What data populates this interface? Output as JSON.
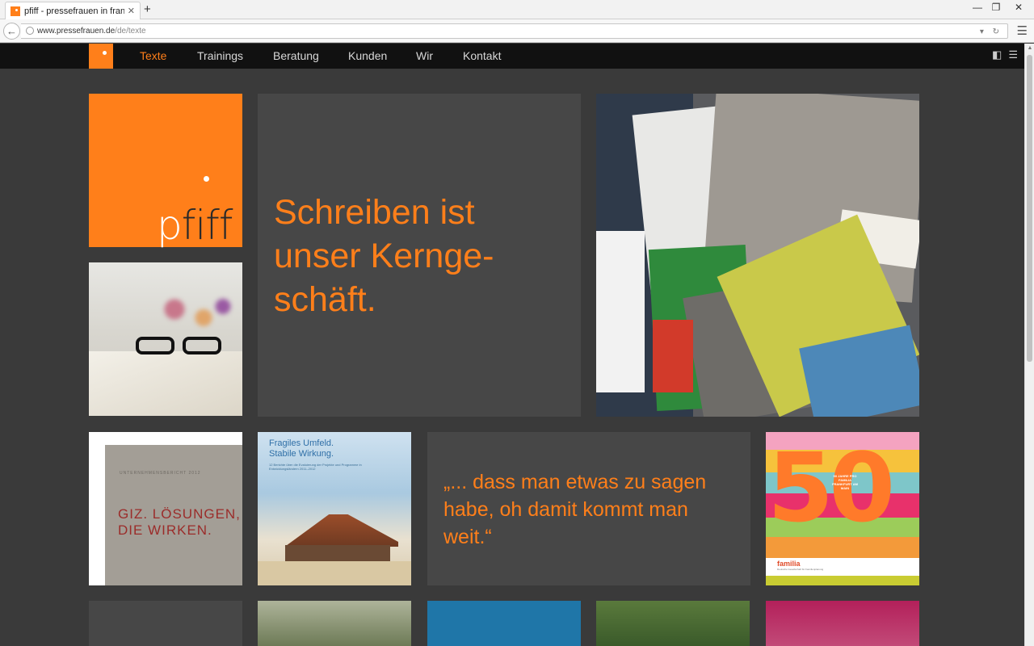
{
  "browser": {
    "tab_title": "pfiff - pressefrauen in frank...",
    "tab_close": "✕",
    "new_tab": "+",
    "url_host": "www.pressefrauen.de",
    "url_path": "/de/texte",
    "win_minimize": "—",
    "win_restore": "❐",
    "win_close": "✕",
    "back": "←",
    "menu": "☰",
    "url_tools": "▾ ↻"
  },
  "nav": {
    "items": [
      {
        "label": "Texte",
        "active": true
      },
      {
        "label": "Trainings"
      },
      {
        "label": "Beratung"
      },
      {
        "label": "Kunden"
      },
      {
        "label": "Wir"
      },
      {
        "label": "Kontakt"
      }
    ],
    "icon_reader": "◧",
    "icon_menu": "☰"
  },
  "logo": {
    "word_white": "p",
    "word_black": "fiff",
    "word_white2": ""
  },
  "headline": "Schreiben ist unser Kernge-schäft.",
  "giz": {
    "small": "UNTERNEHMENSBERICHT 2012",
    "big_line1": "GIZ. LÖSUNGEN,",
    "big_line2": "DIE WIRKEN."
  },
  "fragil": {
    "title_line1": "Fragiles Umfeld.",
    "title_line2": "Stabile Wirkung.",
    "sub": "12 Berichte über die Evaluierung der Projekte und Programme in Entwicklungsländern 2011–2012"
  },
  "quote": "„... dass man etwas zu sagen habe, oh damit kommt man weit.“",
  "fifty": {
    "number": "50",
    "text": "50 JAHRE PRO FAMILIA FRANKFURT AM MAIN",
    "brand": "familia",
    "brand_sub": "Deutsche Gesellschaft für Familienplanung"
  },
  "colors": {
    "accent": "#ff7f1a",
    "page_bg": "#3a3a3a",
    "tile_bg": "#474747",
    "nav_bg": "#111111"
  }
}
